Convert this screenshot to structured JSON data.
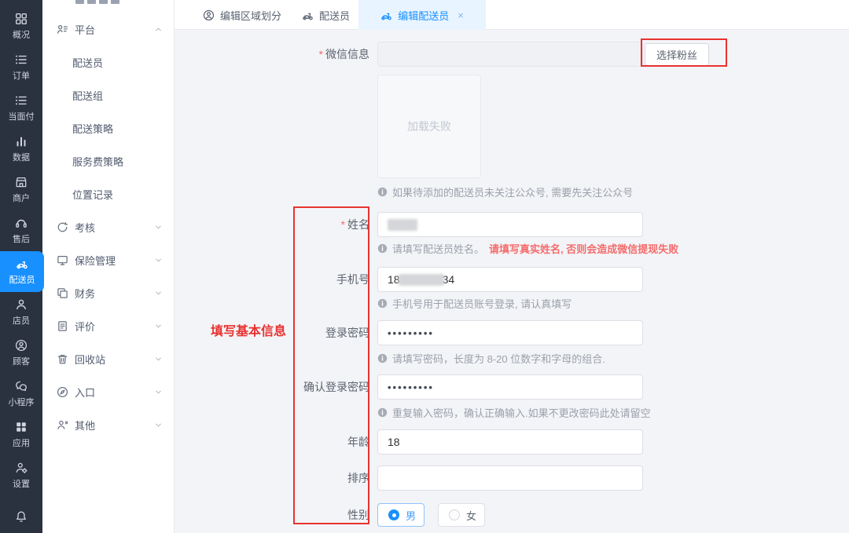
{
  "colors": {
    "accent": "#1890ff",
    "sidebar_bg": "#2a3240",
    "active_tab_bg": "#e8f4ff",
    "annotation_red": "#e83230",
    "warning_red": "#f56c6c"
  },
  "sidebar": {
    "items": [
      {
        "label": "概况",
        "icon": "dashboard-icon"
      },
      {
        "label": "订单",
        "icon": "order-list-icon"
      },
      {
        "label": "当面付",
        "icon": "face-pay-icon"
      },
      {
        "label": "数据",
        "icon": "chart-icon"
      },
      {
        "label": "商户",
        "icon": "store-icon"
      },
      {
        "label": "售后",
        "icon": "headset-icon"
      },
      {
        "label": "配送员",
        "icon": "scooter-icon",
        "active": true
      },
      {
        "label": "店员",
        "icon": "user-icon"
      },
      {
        "label": "顾客",
        "icon": "customer-icon"
      },
      {
        "label": "小程序",
        "icon": "miniprogram-icon"
      },
      {
        "label": "应用",
        "icon": "apps-icon"
      },
      {
        "label": "设置",
        "icon": "settings-icon"
      },
      {
        "label": "",
        "icon": "bell-icon"
      }
    ]
  },
  "menu": {
    "groups": [
      {
        "label": "平台",
        "icon": "platform-icon",
        "expanded": true,
        "children": [
          "配送员",
          "配送组",
          "配送策略",
          "服务费策略",
          "位置记录"
        ]
      },
      {
        "label": "考核",
        "icon": "assessment-icon",
        "expanded": false
      },
      {
        "label": "保险管理",
        "icon": "insurance-icon",
        "expanded": false
      },
      {
        "label": "财务",
        "icon": "finance-icon",
        "expanded": false
      },
      {
        "label": "评价",
        "icon": "review-icon",
        "expanded": false
      },
      {
        "label": "回收站",
        "icon": "recycle-icon",
        "expanded": false
      },
      {
        "label": "入口",
        "icon": "entrance-icon",
        "expanded": false
      },
      {
        "label": "其他",
        "icon": "other-icon",
        "expanded": false
      }
    ]
  },
  "tabs": [
    {
      "label": "编辑区域划分",
      "icon": "avatar-icon",
      "active": false
    },
    {
      "label": "配送员",
      "icon": "scooter-icon",
      "active": false
    },
    {
      "label": "编辑配送员",
      "icon": "scooter-icon",
      "active": true,
      "close_label": "×"
    }
  ],
  "form": {
    "required_mark": "*",
    "wechat": {
      "label": "微信信息",
      "required": true,
      "button": "选择粉丝",
      "image_placeholder": "加载失败",
      "note": "如果待添加的配送员未关注公众号, 需要先关注公众号"
    },
    "name": {
      "label": "姓名",
      "required": true,
      "value_redacted": true,
      "note_gray": "请填写配送员姓名。",
      "note_red": "请填写真实姓名, 否则会造成微信提现失败"
    },
    "phone": {
      "label": "手机号",
      "value_prefix": "18",
      "value_suffix": "34",
      "note": "手机号用于配送员账号登录, 请认真填写"
    },
    "password": {
      "label": "登录密码",
      "value": "•••••••••",
      "note": "请填写密码，长度为 8-20 位数字和字母的组合."
    },
    "confirm_password": {
      "label": "确认登录密码",
      "value": "•••••••••",
      "note": "重复输入密码，确认正确输入.如果不更改密码此处请留空"
    },
    "age": {
      "label": "年龄",
      "value": "18"
    },
    "sort": {
      "label": "排序",
      "value": ""
    },
    "gender": {
      "label": "性别",
      "options": [
        {
          "label": "男",
          "selected": true
        },
        {
          "label": "女",
          "selected": false
        }
      ]
    }
  },
  "annotations": {
    "basic_info_label": "填写基本信息"
  }
}
